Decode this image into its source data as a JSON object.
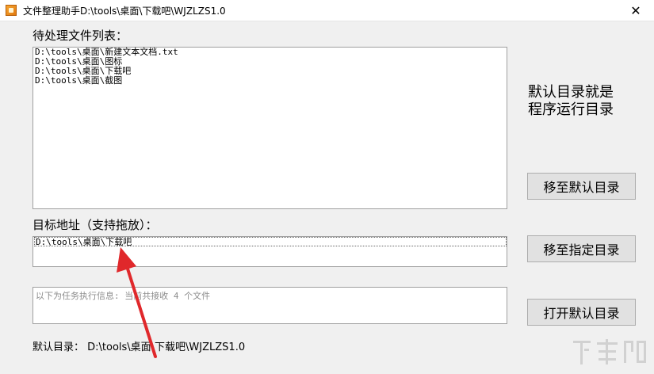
{
  "window": {
    "title": "文件整理助手D:\\tools\\桌面\\下载吧\\WJZLZS1.0",
    "close_glyph": "✕"
  },
  "pending": {
    "label": "待处理文件列表：",
    "items": [
      "D:\\tools\\桌面\\新建文本文档.txt",
      "D:\\tools\\桌面\\图标",
      "D:\\tools\\桌面\\下载吧",
      "D:\\tools\\桌面\\截图"
    ]
  },
  "target": {
    "label": "目标地址（支持拖放）：",
    "value": "D:\\tools\\桌面\\下载吧"
  },
  "info": {
    "text": "以下为任务执行信息: 当前共接收 4 个文件"
  },
  "note": {
    "line1": "默认目录就是",
    "line2": "程序运行目录"
  },
  "buttons": {
    "move_default": "移至默认目录",
    "move_specified": "移至指定目录",
    "open_default": "打开默认目录"
  },
  "footer": {
    "text": "默认目录： D:\\tools\\桌面\\下载吧\\WJZLZS1.0"
  },
  "colors": {
    "arrow": "#e0282b"
  },
  "watermark": {
    "icon": "xiazaiba-logo-watermark"
  }
}
